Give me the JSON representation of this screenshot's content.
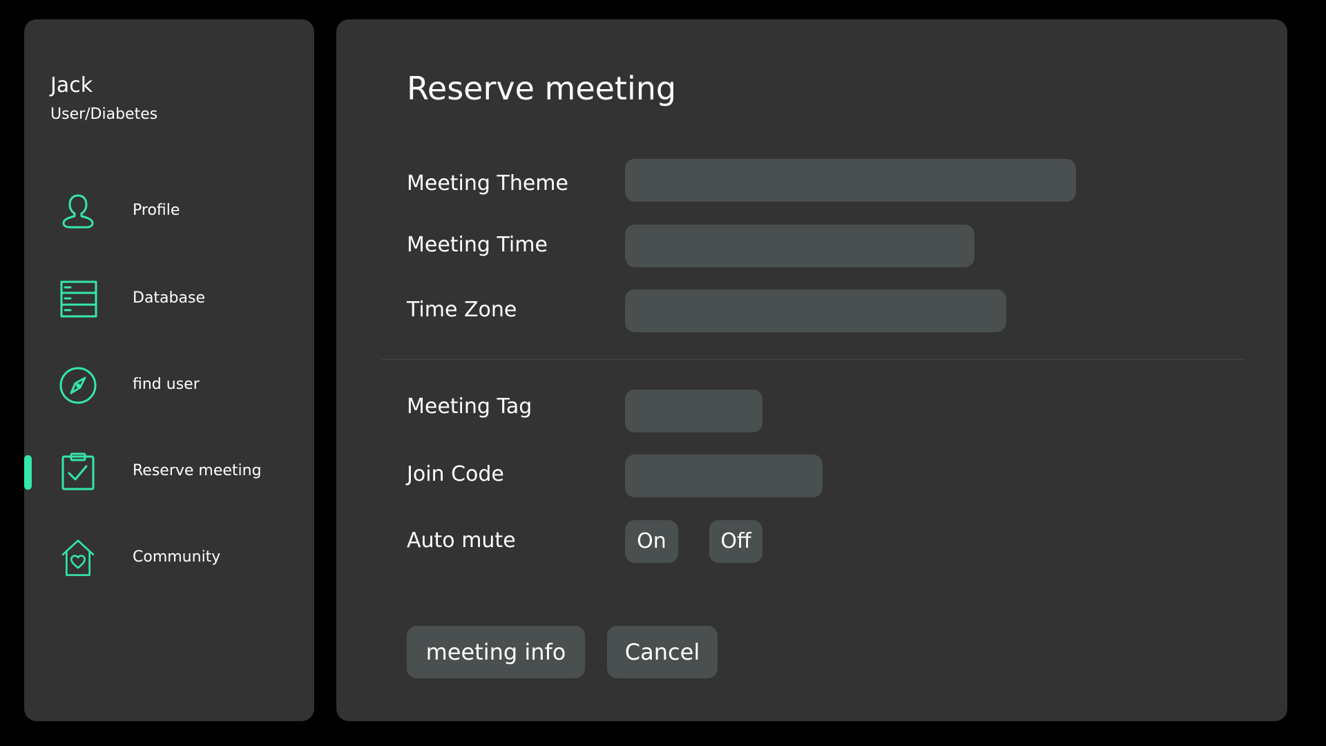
{
  "colors": {
    "accent": "#34e8aa",
    "panel_bg": "#333333",
    "input_bg": "#4a4f4f",
    "page_bg": "#000000",
    "text": "#ffffff"
  },
  "user": {
    "name": "Jack",
    "role": "User/Diabetes"
  },
  "sidebar": {
    "active_item": "Reserve meeting",
    "items": [
      {
        "label": "Profile",
        "icon": "person-icon"
      },
      {
        "label": "Database",
        "icon": "list-document-icon"
      },
      {
        "label": "find user",
        "icon": "compass-icon"
      },
      {
        "label": "Reserve meeting",
        "icon": "clipboard-check-icon"
      },
      {
        "label": "Community",
        "icon": "house-heart-icon"
      }
    ]
  },
  "form": {
    "title": "Reserve meeting",
    "fields": {
      "meeting_theme": {
        "label": "Meeting Theme",
        "value": ""
      },
      "meeting_time": {
        "label": "Meeting Time",
        "value": ""
      },
      "time_zone": {
        "label": "Time Zone",
        "value": ""
      },
      "meeting_tag": {
        "label": "Meeting Tag",
        "value": ""
      },
      "join_code": {
        "label": "Join Code",
        "value": ""
      }
    },
    "auto_mute": {
      "label": "Auto mute",
      "on_label": "On",
      "off_label": "Off"
    },
    "buttons": {
      "meeting_info": "meeting info",
      "cancel": "Cancel"
    }
  }
}
